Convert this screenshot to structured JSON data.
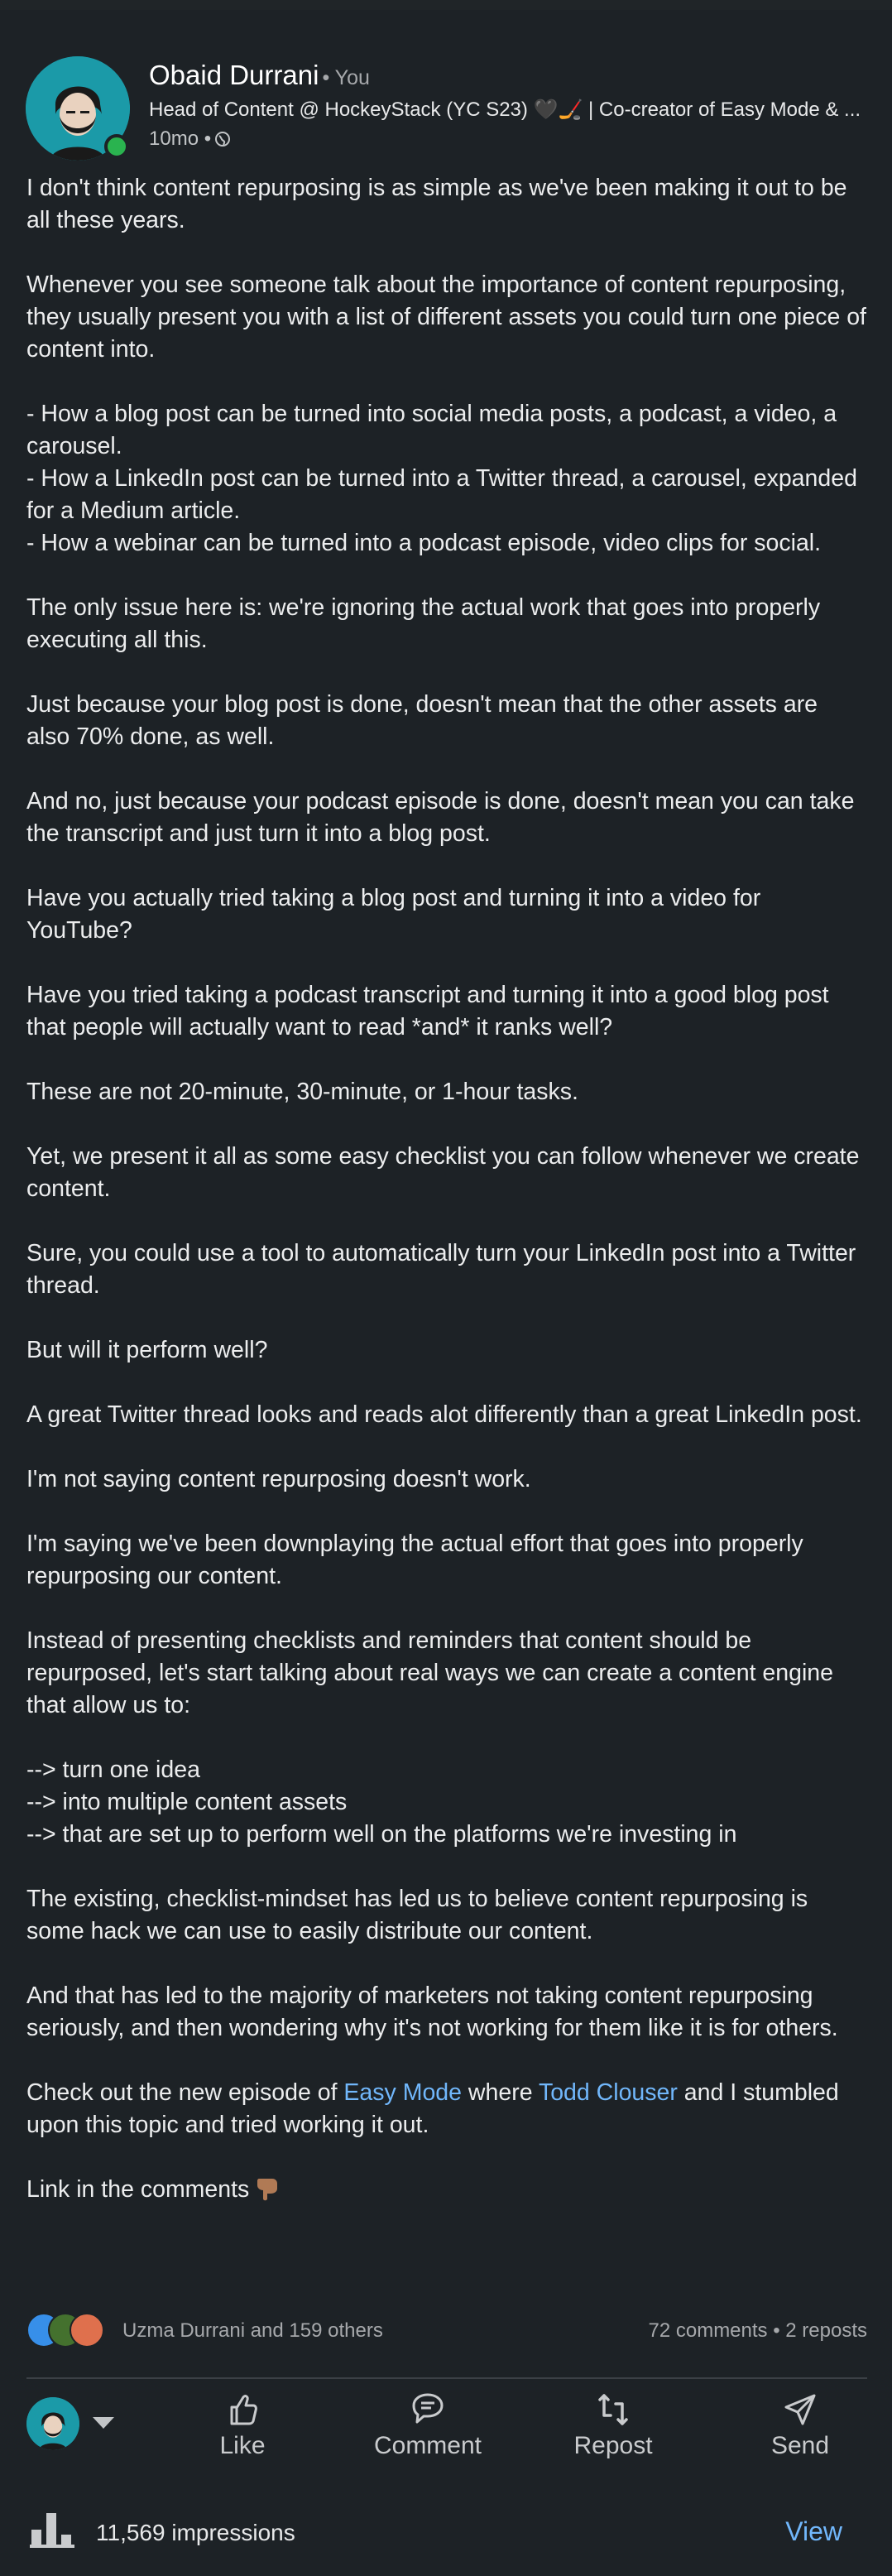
{
  "author": {
    "name": "Obaid Durrani",
    "badge": "• You",
    "headline": "Head of Content @ HockeyStack (YC S23) 🖤🏒 | Co-creator of Easy Mode & ...",
    "time": "10mo •"
  },
  "post": {
    "paragraphs": [
      "I don't think content repurposing is as simple as we've been making it out to be all these years.",
      "Whenever you see someone talk about the importance of content repurposing, they usually present you with a list of different assets you could turn one piece of content into."
    ],
    "list1": [
      "- How a blog post can be turned into social media posts, a podcast, a video, a carousel.",
      "- How a LinkedIn post can be turned into a Twitter thread, a carousel, expanded for a Medium article.",
      "- How a webinar can be turned into a podcast episode, video clips for social."
    ],
    "paragraphs2": [
      "The only issue here is: we're ignoring the actual work that goes into properly executing all this.",
      "Just because your blog post is done, doesn't mean that the other assets are also 70% done, as well.",
      "And no, just because your podcast episode is done, doesn't mean you can take the transcript and just turn it into a blog post.",
      "Have you actually tried taking a blog post and turning it into a video for YouTube?",
      "Have you tried taking a podcast transcript and turning it into a good blog post that people will actually want to read *and* it ranks well?",
      "These are not 20-minute, 30-minute, or 1-hour tasks.",
      "Yet, we present it all as some easy checklist you can follow whenever we create content.",
      "Sure, you could use a tool to automatically turn your LinkedIn post into a Twitter thread.",
      "But will it perform well?",
      "A great Twitter thread looks and reads alot differently than a great LinkedIn post.",
      "I'm not saying content repurposing doesn't work.",
      "I'm saying we've been downplaying the actual effort that goes into properly repurposing our content.",
      "Instead of presenting checklists and reminders that content should be repurposed, let's start talking about real ways we can create a content engine that allow us to:"
    ],
    "list2": [
      "--> turn one idea",
      "--> into multiple content assets",
      "--> that are set up to perform well on the platforms we're investing in"
    ],
    "paragraphs3": [
      "The existing, checklist-mindset has led us to believe content repurposing is some hack we can use to easily distribute our content.",
      "And that has led to the majority of marketers not taking content repurposing seriously, and then wondering why it's not working for them like it is for others."
    ],
    "cta": {
      "prefix": "Check out the new episode of ",
      "link1": "Easy Mode",
      "middle": " where ",
      "link2": "Todd Clouser",
      "suffix": " and I stumbled upon this topic and tried working it out."
    },
    "closing": "Link in the comments"
  },
  "social": {
    "reactors": "Uzma Durrani and 159 others",
    "counts": "72 comments • 2 reposts",
    "reaction_icons": [
      "like-icon",
      "celebrate-icon",
      "love-icon"
    ]
  },
  "actions": {
    "like": "Like",
    "comment": "Comment",
    "repost": "Repost",
    "send": "Send"
  },
  "footer": {
    "impressions": "11,569 impressions",
    "view": "View"
  },
  "colors": {
    "background": "#1d2226",
    "link": "#71b7fb",
    "avatar_bg": "#1b9aa8",
    "online": "#2ab34f"
  }
}
